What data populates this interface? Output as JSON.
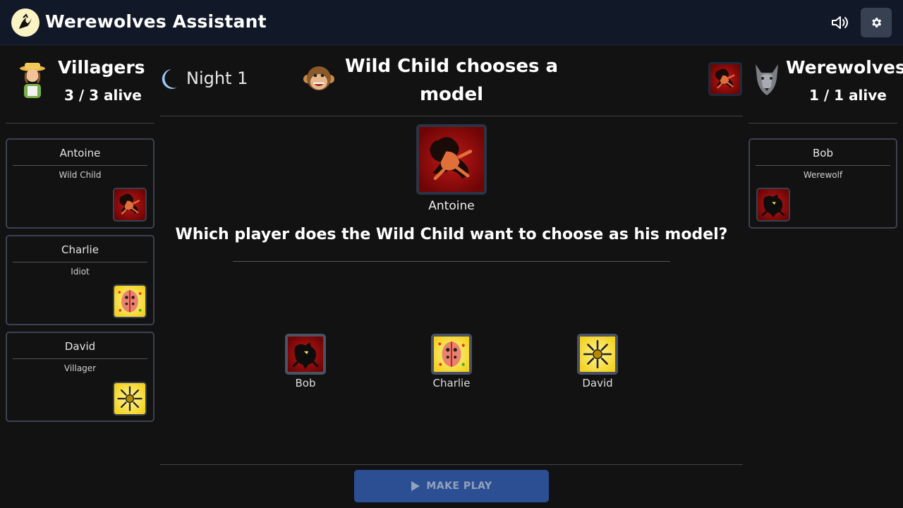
{
  "app": {
    "title": "Werewolves Assistant"
  },
  "header": {
    "sound_icon": "speaker-icon",
    "settings_icon": "gear-icon"
  },
  "villagers": {
    "name": "Villagers",
    "alive": "3 / 3 alive",
    "players": [
      {
        "name": "Antoine",
        "role": "Wild Child",
        "card": "wild-child"
      },
      {
        "name": "Charlie",
        "role": "Idiot",
        "card": "idiot"
      },
      {
        "name": "David",
        "role": "Villager",
        "card": "villager"
      }
    ]
  },
  "werewolves": {
    "name": "Werewolves",
    "alive": "1 / 1 alive",
    "players": [
      {
        "name": "Bob",
        "role": "Werewolf",
        "card": "werewolf"
      }
    ]
  },
  "game": {
    "phase": "Night 1",
    "step_title": "Wild Child chooses a model",
    "current_player": "Antoine",
    "question": "Which player does the Wild Child want to choose as his model?",
    "choices": [
      {
        "name": "Bob",
        "card": "werewolf"
      },
      {
        "name": "Charlie",
        "card": "idiot"
      },
      {
        "name": "David",
        "card": "villager"
      }
    ],
    "action_label": "MAKE PLAY"
  },
  "colors": {
    "background": "#121212",
    "header_bg": "#111827",
    "button_blue": "#2c4f94",
    "card_border": "#3b4250",
    "moon": "#9cc6f5"
  }
}
